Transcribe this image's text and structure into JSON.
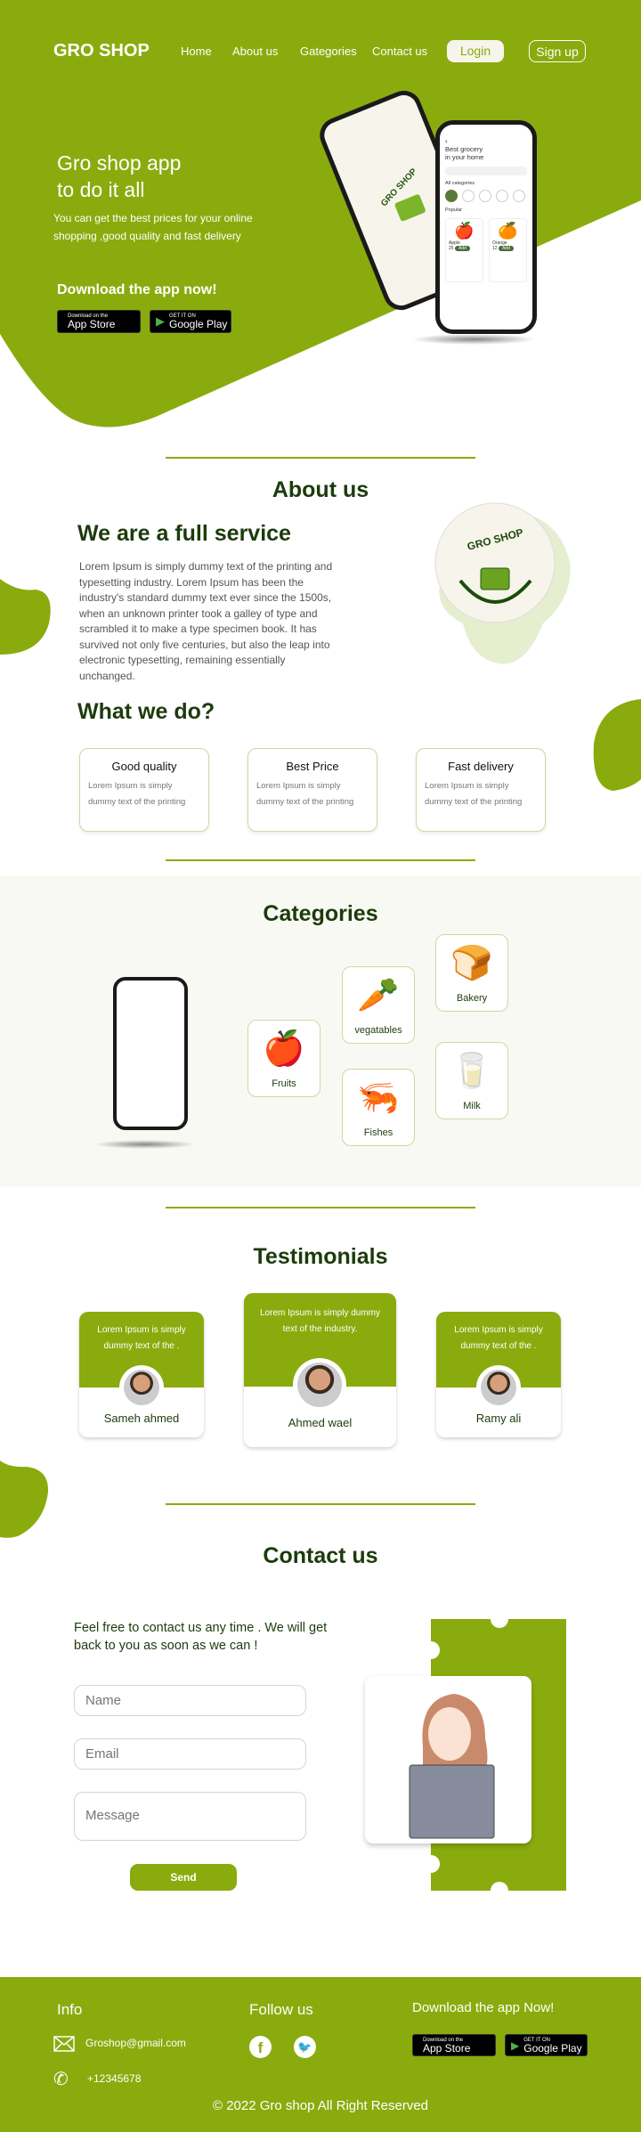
{
  "colors": {
    "brand": "#8aab0d",
    "heading": "#1c3b0b",
    "light": "#e5eecf"
  },
  "header": {
    "logo": "GRO SHOP",
    "nav": [
      "Home",
      "About us",
      "Gategories",
      "Contact us"
    ],
    "login": "Login",
    "signup": "Sign up"
  },
  "hero": {
    "title_line1": "Gro shop app",
    "title_line2": "to do it all",
    "text_line1": "You can get the best prices for your online",
    "text_line2": "shopping ,good quality and fast delivery",
    "download": "Download the app now!",
    "app_store": {
      "small": "Download on the",
      "large": "App Store"
    },
    "google_play": {
      "small": "GET IT ON",
      "large": "Google Play"
    },
    "phone": {
      "title_line1": "Best grocery",
      "title_line2": "in your home",
      "categories_label": "All categories",
      "popular_label": "Popular",
      "items": [
        {
          "name": "Apple",
          "price": "25",
          "add": "Add"
        },
        {
          "name": "Orange",
          "price": "12",
          "add": "Add"
        }
      ],
      "splash_logo": "GRO SHOP"
    }
  },
  "about": {
    "title": "About us",
    "subtitle": "We are a full service",
    "paragraph": "Lorem Ipsum is simply dummy text of the printing and typesetting industry. Lorem Ipsum has been the industry's standard dummy text ever since the 1500s, when an unknown printer took a galley of type and scrambled it to make a type specimen book. It has survived not only five centuries, but also the leap into electronic typesetting, remaining essentially unchanged.",
    "logo_text": "GRO SHOP",
    "what_title": "What we do?",
    "cards": [
      {
        "title": "Good quality",
        "text": "Lorem Ipsum is simply dummy text of the printing"
      },
      {
        "title": "Best Price",
        "text": "Lorem Ipsum is simply dummy text of the printing"
      },
      {
        "title": "Fast delivery",
        "text": "Lorem Ipsum is simply dummy text of the printing"
      }
    ]
  },
  "categories": {
    "title": "Categories",
    "items": [
      {
        "label": "Fruits",
        "icon": "fruit-bowl-icon"
      },
      {
        "label": "vegatables",
        "icon": "vegetables-icon"
      },
      {
        "label": "Bakery",
        "icon": "bread-icon"
      },
      {
        "label": "Fishes",
        "icon": "fish-shrimp-icon"
      },
      {
        "label": "Milk",
        "icon": "milk-bottle-icon"
      }
    ]
  },
  "testimonials": {
    "title": "Testimonials",
    "items": [
      {
        "text": "Lorem Ipsum is simply dummy text of the .",
        "name": "Sameh ahmed"
      },
      {
        "text": "Lorem Ipsum is simply dummy text of the industry.",
        "name": "Ahmed wael"
      },
      {
        "text": "Lorem Ipsum is simply dummy text of the .",
        "name": "Ramy ali"
      }
    ]
  },
  "contact": {
    "title": "Contact us",
    "text": "Feel free to contact us any time . We will get back to you as soon as we can !",
    "name_placeholder": "Name",
    "email_placeholder": "Email",
    "message_placeholder": "Message",
    "send": "Send"
  },
  "footer": {
    "info_title": "Info",
    "email": "Groshop@gmail.com",
    "phone": "+12345678",
    "follow_title": "Follow us",
    "download_title": "Download the app Now!",
    "copyright": "© 2022 Gro shop All Right Reserved"
  }
}
